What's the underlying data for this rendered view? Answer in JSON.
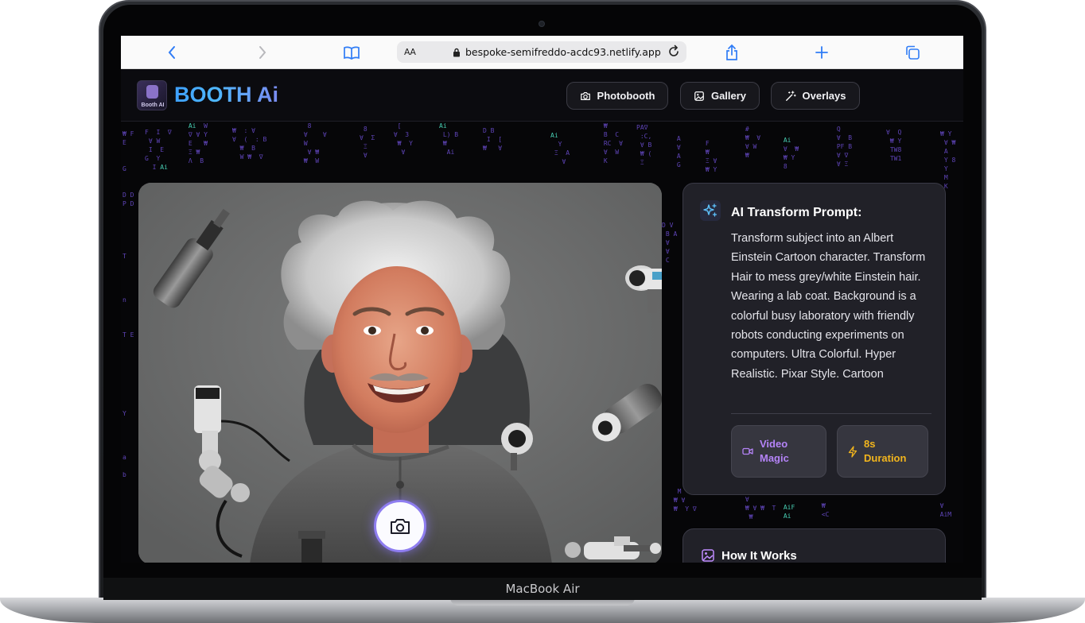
{
  "device": {
    "label": "MacBook Air"
  },
  "browser": {
    "url": "bespoke-semifreddo-acdc93.netlify.app",
    "aa_label": "AA",
    "icons": [
      "chevron-left-icon",
      "chevron-right-icon",
      "book-icon",
      "lock-icon",
      "reload-icon",
      "share-icon",
      "plus-icon",
      "tabs-icon"
    ]
  },
  "header": {
    "logo_caption": "Booth AI",
    "title": "BOOTH Ai",
    "nav": [
      {
        "label": "Photobooth",
        "icon": "camera-icon"
      },
      {
        "label": "Gallery",
        "icon": "image-icon"
      },
      {
        "label": "Overlays",
        "icon": "wand-icon"
      }
    ]
  },
  "prompt_card": {
    "title": "AI Transform Prompt:",
    "text": "Transform subject into an Albert Einstein Cartoon character. Transform Hair to mess grey/white Einstein hair. Wearing a lab coat. Background is a colorful busy laboratory with friendly robots conducting experiments on computers. Ultra Colorful. Hyper Realistic. Pixar Style. Cartoon",
    "chips": [
      {
        "label": "Video Magic",
        "icon": "video-icon",
        "color": "#b483f7"
      },
      {
        "label": "8s Duration",
        "icon": "lightning-icon",
        "color": "#f2b51d"
      }
    ]
  },
  "how_card": {
    "title": "How It Works"
  },
  "colors": {
    "accent": "#8e7df0",
    "brand_blue": "#3ea0ff",
    "matrix_purple": "#6e4fd6",
    "matrix_green": "#53f0d0"
  }
}
